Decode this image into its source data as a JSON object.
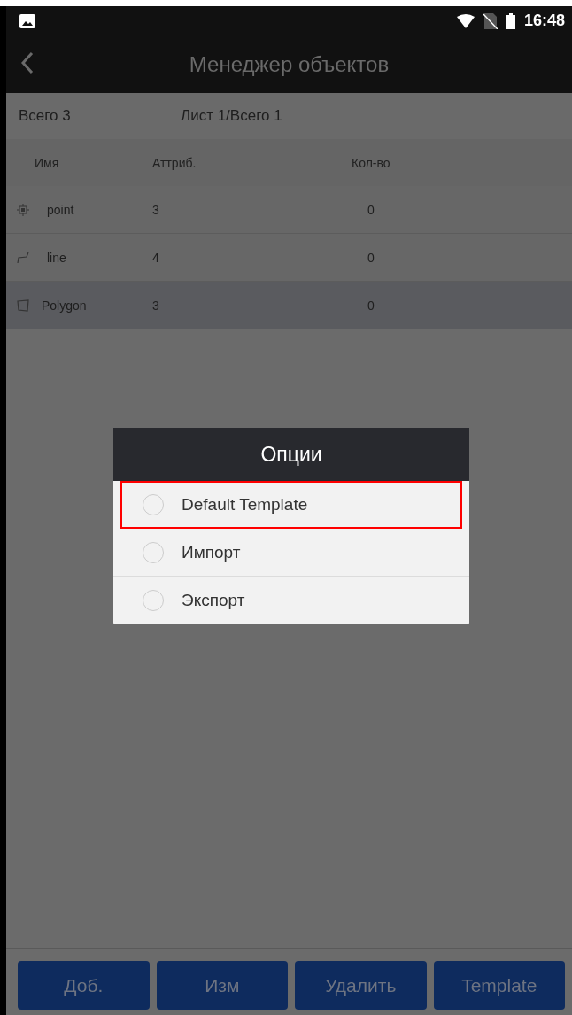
{
  "status_bar": {
    "time": "16:48"
  },
  "title_bar": {
    "title": "Менеджер объектов"
  },
  "summary": {
    "total": "Всего 3",
    "page": "Лист 1/Всего 1"
  },
  "table": {
    "columns": [
      "Имя",
      "Аттриб.",
      "Кол-во"
    ],
    "rows": [
      {
        "kind": "point",
        "name": "point",
        "attributes": "3",
        "count": "0",
        "selected": false
      },
      {
        "kind": "line",
        "name": "line",
        "attributes": "4",
        "count": "0",
        "selected": false
      },
      {
        "kind": "polygon",
        "name": "Polygon",
        "attributes": "3",
        "count": "0",
        "selected": true
      }
    ]
  },
  "dialog": {
    "title": "Опции",
    "options": [
      {
        "label": "Default Template",
        "selected": false,
        "highlighted": true
      },
      {
        "label": "Импорт",
        "selected": false,
        "highlighted": false
      },
      {
        "label": "Экспорт",
        "selected": false,
        "highlighted": false
      }
    ]
  },
  "buttons": [
    "Доб.",
    "Изм",
    "Удалить",
    "Template"
  ]
}
